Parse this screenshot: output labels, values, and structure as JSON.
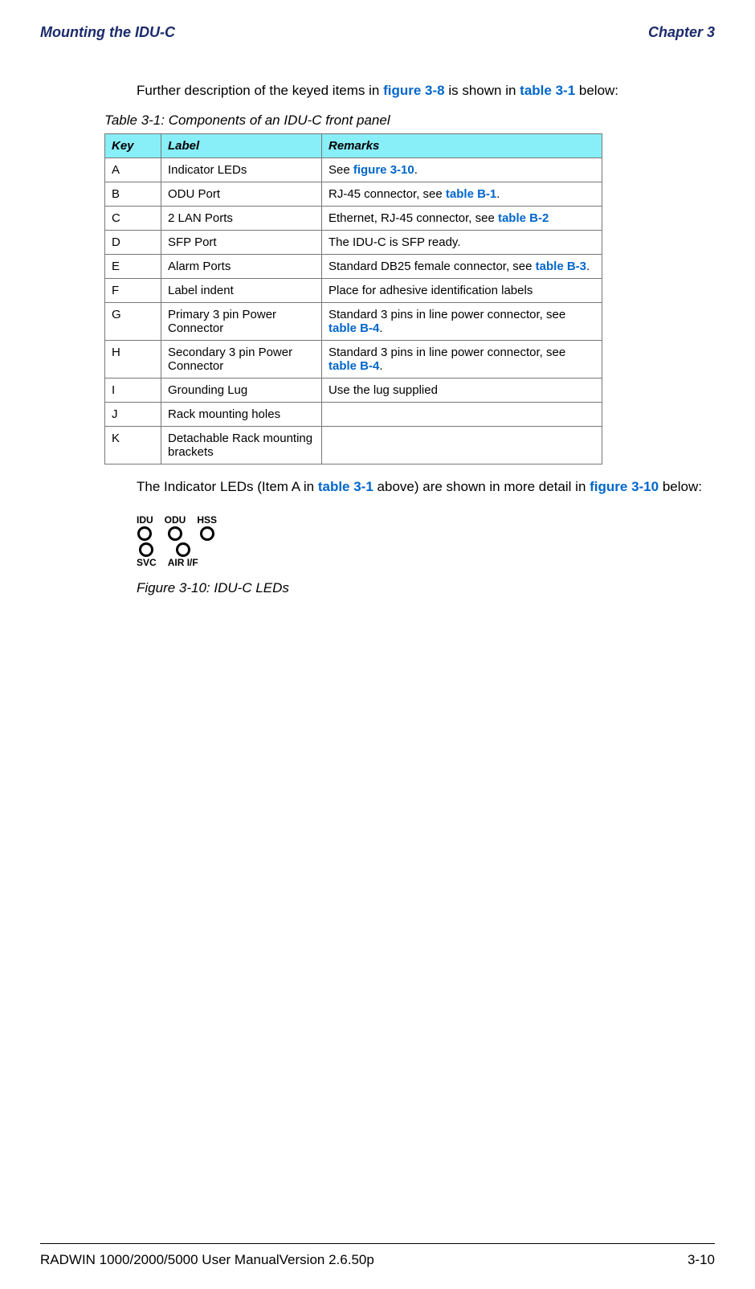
{
  "header": {
    "left": "Mounting the IDU-C",
    "right": "Chapter 3"
  },
  "intro": {
    "pre": "Further description of the keyed items in ",
    "fig_ref": "figure 3-8",
    "mid": " is shown in ",
    "tab_ref": "table 3-1",
    "post": " below:"
  },
  "table_caption": "Table 3-1: Components of an IDU-C front panel",
  "table_headers": {
    "key": "Key",
    "label": "Label",
    "remarks": "Remarks"
  },
  "rows": [
    {
      "key": "A",
      "label": "Indicator LEDs",
      "pre": "See ",
      "link": "figure 3-10",
      "post": "."
    },
    {
      "key": "B",
      "label": "ODU Port",
      "pre": "RJ-45 connector, see ",
      "link": "table B-1",
      "post": "."
    },
    {
      "key": "C",
      "label": "2 LAN Ports",
      "pre": "Ethernet, RJ-45 connector, see ",
      "link": "table B-2",
      "post": ""
    },
    {
      "key": "D",
      "label": "SFP Port",
      "pre": "The IDU-C is SFP ready.",
      "link": "",
      "post": ""
    },
    {
      "key": "E",
      "label": "Alarm Ports",
      "pre": "Standard DB25 female connector, see ",
      "link": "table B-3",
      "post": "."
    },
    {
      "key": "F",
      "label": "Label indent",
      "pre": "Place for adhesive identification labels",
      "link": "",
      "post": ""
    },
    {
      "key": "G",
      "label": "Primary 3 pin Power Connector",
      "pre": "Standard 3 pins in line power connector, see ",
      "link": "table B-4",
      "post": "."
    },
    {
      "key": "H",
      "label": "Secondary 3 pin Power Connector",
      "pre": "Standard 3 pins in line power connector, see ",
      "link": "table B-4",
      "post": "."
    },
    {
      "key": "I",
      "label": "Grounding Lug",
      "pre": "Use the lug supplied",
      "link": "",
      "post": ""
    },
    {
      "key": "J",
      "label": "Rack mounting holes",
      "pre": "",
      "link": "",
      "post": ""
    },
    {
      "key": "K",
      "label": "Detachable Rack mounting brackets",
      "pre": "",
      "link": "",
      "post": ""
    }
  ],
  "after_table": {
    "pre": "The Indicator LEDs (Item A in ",
    "link1": "table 3-1",
    "mid": " above) are shown in more detail in ",
    "link2": "figure 3-10",
    "post": " below:"
  },
  "leds": {
    "top": [
      "IDU",
      "ODU",
      "HSS"
    ],
    "bottom": [
      "SVC",
      "AIR I/F"
    ]
  },
  "fig_caption": "Figure 3-10: IDU-C LEDs",
  "footer": {
    "left": "RADWIN 1000/2000/5000 User ManualVersion  2.6.50p",
    "right": "3-10"
  }
}
